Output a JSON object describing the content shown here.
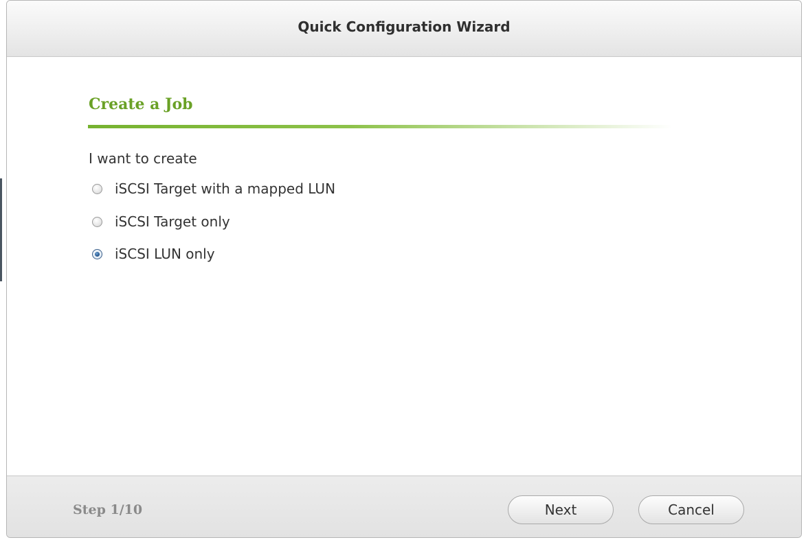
{
  "window": {
    "title": "Quick Configuration Wizard"
  },
  "section": {
    "heading": "Create a Job",
    "intro": "I want to create"
  },
  "options": [
    {
      "label": "iSCSI Target with a mapped LUN",
      "selected": false
    },
    {
      "label": "iSCSI Target only",
      "selected": false
    },
    {
      "label": "iSCSI LUN only",
      "selected": true
    }
  ],
  "footer": {
    "step": "Step 1/10",
    "next_label": "Next",
    "cancel_label": "Cancel"
  },
  "colors": {
    "heading_green": "#6aa126",
    "selected_radio_blue": "#1f4f86"
  }
}
